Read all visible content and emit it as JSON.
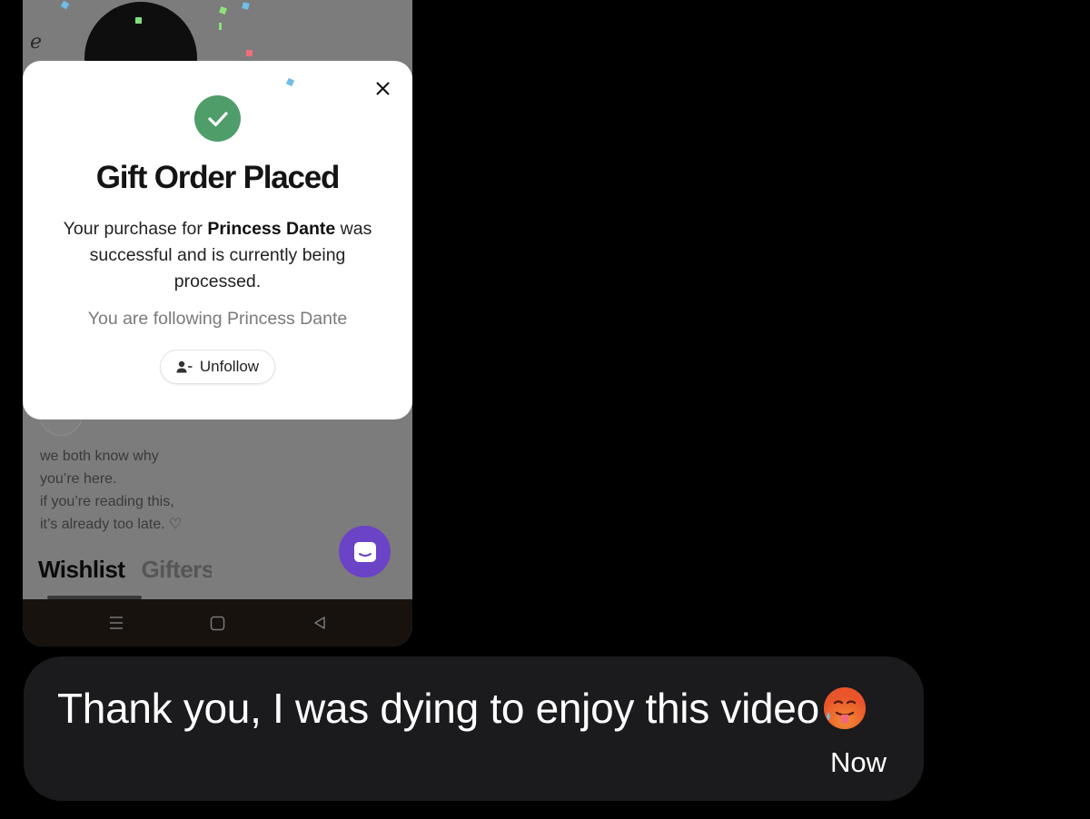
{
  "background_page": {
    "partial_letter": "e",
    "bio_lines": [
      "we both know why",
      "you’re here.",
      "if you’re reading this,",
      "it’s already too late. ♡"
    ],
    "tabs": [
      {
        "label": "Wishlist"
      },
      {
        "label": "Gifters"
      }
    ]
  },
  "modal": {
    "title": "Gift Order Placed",
    "message_prefix": "Your purchase for ",
    "recipient": "Princess Dante",
    "message_suffix": " was successful and is currently being processed.",
    "follow_status": "You are following Princess Dante",
    "unfollow_label": "Unfollow",
    "accent_color": "#4f9d69"
  },
  "chat": {
    "message": "Thank you, I was dying to enjoy this video",
    "emoji": "hot-face-tongue",
    "time": "Now"
  },
  "colors": {
    "chat_fab": "#6a43c6",
    "bubble": "#1b1b1d"
  }
}
